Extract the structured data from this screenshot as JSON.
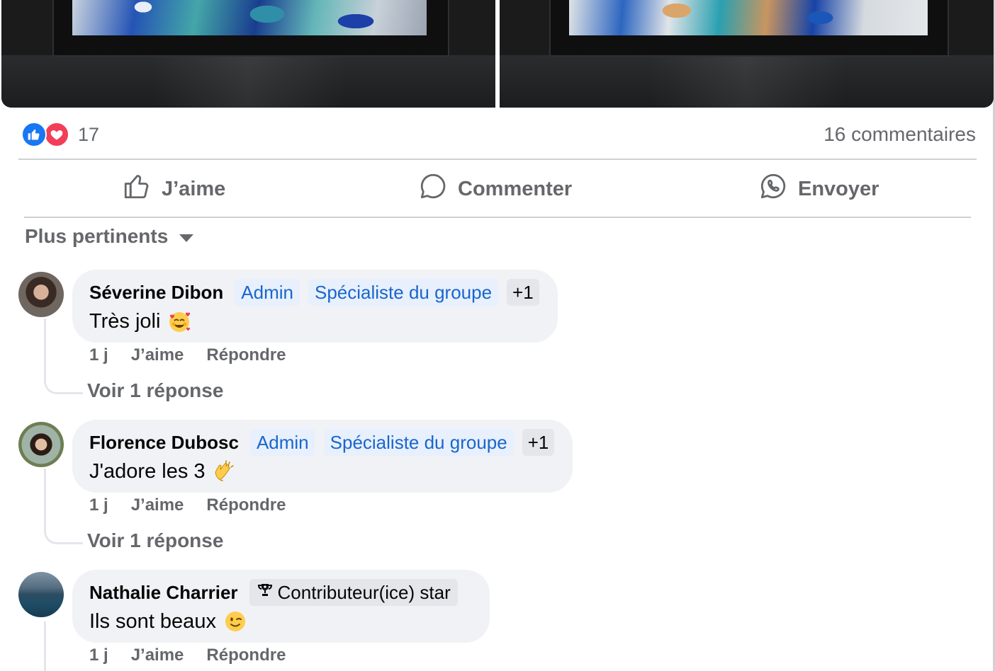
{
  "post": {
    "reaction_count": "17",
    "comments_count": "16 commentaires",
    "actions": {
      "like": "J’aime",
      "comment": "Commenter",
      "send": "Envoyer"
    },
    "sort_label": "Plus pertinents"
  },
  "comments": [
    {
      "author": "Séverine Dibon",
      "badges": [
        "Admin",
        "Spécialiste du groupe"
      ],
      "extra_badges": "+1",
      "text": "Très joli",
      "emoji": "smiling-face-with-hearts",
      "time": "1 j",
      "like": "J’aime",
      "reply": "Répondre",
      "view_replies": "Voir 1 réponse"
    },
    {
      "author": "Florence Dubosc",
      "badges": [
        "Admin",
        "Spécialiste du groupe"
      ],
      "extra_badges": "+1",
      "text": "J'adore les 3",
      "emoji": "clapping-hands",
      "time": "1 j",
      "like": "J’aime",
      "reply": "Répondre",
      "view_replies": "Voir 1 réponse"
    },
    {
      "author": "Nathalie Charrier",
      "star_badge": "Contributeur(ice) star",
      "text": "Ils sont beaux",
      "emoji": "winking-face",
      "time": "1 j",
      "like": "J’aime",
      "reply": "Répondre"
    }
  ],
  "colors": {
    "like_blue": "#1877f2",
    "love_red": "#f33e58",
    "badge_text": "#1a66cc",
    "muted_text": "#65676b",
    "bubble_bg": "#f0f2f5"
  }
}
